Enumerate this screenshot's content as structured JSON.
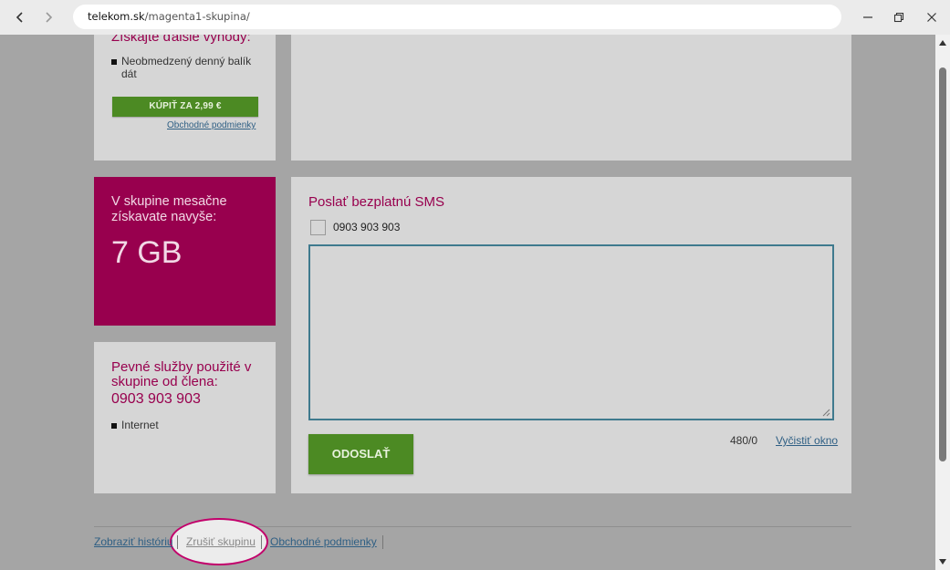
{
  "browser": {
    "url_host": "telekom.sk",
    "url_path": "/magenta1-skupina/"
  },
  "offer_panel": {
    "heading": "Získajte ďalšie výhody:",
    "bullet_line1": "Neobmedzený denný balík",
    "bullet_line2": "dát",
    "buy_label": "KÚPIŤ ZA 2,99 €",
    "terms_label": "Obchodné podmienky"
  },
  "group_panel": {
    "line1": "V skupine mesačne",
    "line2": "získavate navyše:",
    "amount": "7 GB"
  },
  "fixed_panel": {
    "line1": "Pevné služby použité v",
    "line2": "skupine od člena:",
    "number": "0903 903 903",
    "service": "Internet"
  },
  "sms_panel": {
    "title": "Poslať bezplatnú SMS",
    "recipient": "0903 903 903",
    "message_value": "",
    "send_label": "ODOSLAŤ",
    "counter": "480/0",
    "clear_label": "Vyčistiť okno"
  },
  "footer": {
    "history_label": "Zobraziť históriu",
    "cancel_group_label": "Zrušiť skupinu",
    "terms_label": "Obchodné podmienky"
  },
  "colors": {
    "magenta": "#98004e",
    "green": "#4c8a23",
    "link": "#2f5f84",
    "highlight": "#c2006b"
  }
}
